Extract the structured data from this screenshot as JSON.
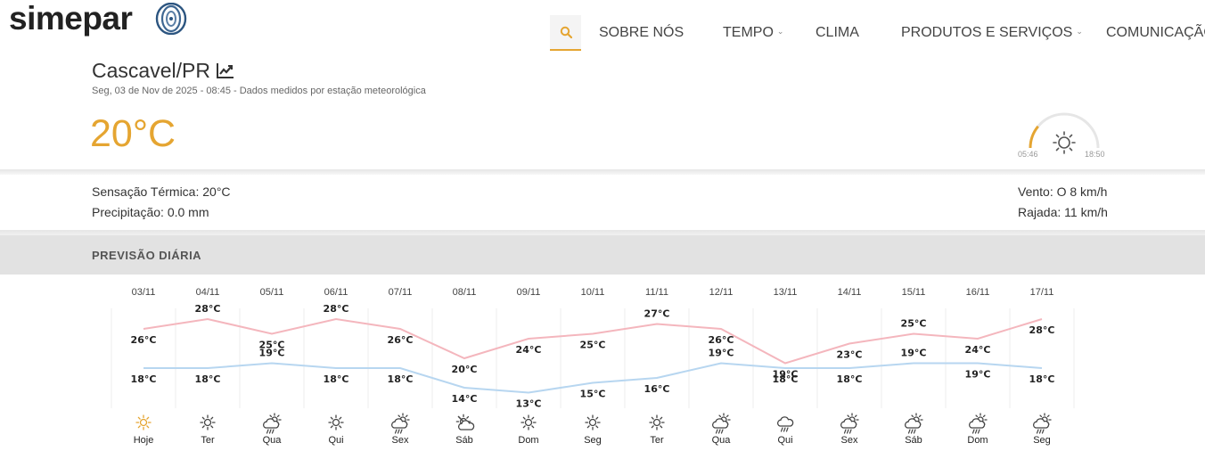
{
  "header": {
    "logo_text": "simepar",
    "nav": [
      {
        "label": "SOBRE NÓS",
        "has_menu": false
      },
      {
        "label": "TEMPO",
        "has_menu": true
      },
      {
        "label": "CLIMA",
        "has_menu": false
      },
      {
        "label": "PRODUTOS E SERVIÇOS",
        "has_menu": true
      },
      {
        "label": "COMUNICAÇÃO",
        "has_menu": false
      }
    ]
  },
  "current": {
    "city": "Cascavel/PR",
    "subline": "Seg, 03 de Nov de 2025 - 08:45 - Dados medidos por estação meteorológica",
    "temperature": "20°C",
    "sunrise": "05:46",
    "sunset": "18:50",
    "sun_progress": 0.22,
    "feels_like": "Sensação Térmica: 20°C",
    "precipitation": "Precipitação: 0.0 mm",
    "wind": "Vento: O 8 km/h",
    "gust": "Rajada: 11 km/h"
  },
  "forecast": {
    "title": "PREVISÃO DIÁRIA",
    "colors": {
      "max": "#f4b6bd",
      "min": "#b7d6f0",
      "accent": "#e5a531"
    }
  },
  "chart_data": {
    "type": "line",
    "categories": [
      "03/11",
      "04/11",
      "05/11",
      "06/11",
      "07/11",
      "08/11",
      "09/11",
      "10/11",
      "11/11",
      "12/11",
      "13/11",
      "14/11",
      "15/11",
      "16/11",
      "17/11"
    ],
    "days": [
      "Hoje",
      "Ter",
      "Qua",
      "Qui",
      "Sex",
      "Sáb",
      "Dom",
      "Seg",
      "Ter",
      "Qua",
      "Qui",
      "Sex",
      "Sáb",
      "Dom",
      "Seg"
    ],
    "icons": [
      "sun-icon",
      "sun-icon",
      "sun-rain-icon",
      "sun-icon",
      "sun-rain-icon",
      "sun-cloud-icon",
      "sun-icon",
      "sun-icon",
      "sun-icon",
      "sun-rain-icon",
      "cloud-rain-icon",
      "sun-rain-icon",
      "sun-rain-icon",
      "sun-rain-icon",
      "sun-rain-icon"
    ],
    "series": [
      {
        "values": [
          26,
          28,
          25,
          28,
          26,
          20,
          24,
          25,
          27,
          26,
          19,
          23,
          25,
          24,
          28
        ]
      },
      {
        "values": [
          18,
          18,
          19,
          18,
          18,
          14,
          13,
          15,
          16,
          19,
          18,
          18,
          19,
          19,
          18
        ]
      }
    ],
    "unit": "°C"
  }
}
